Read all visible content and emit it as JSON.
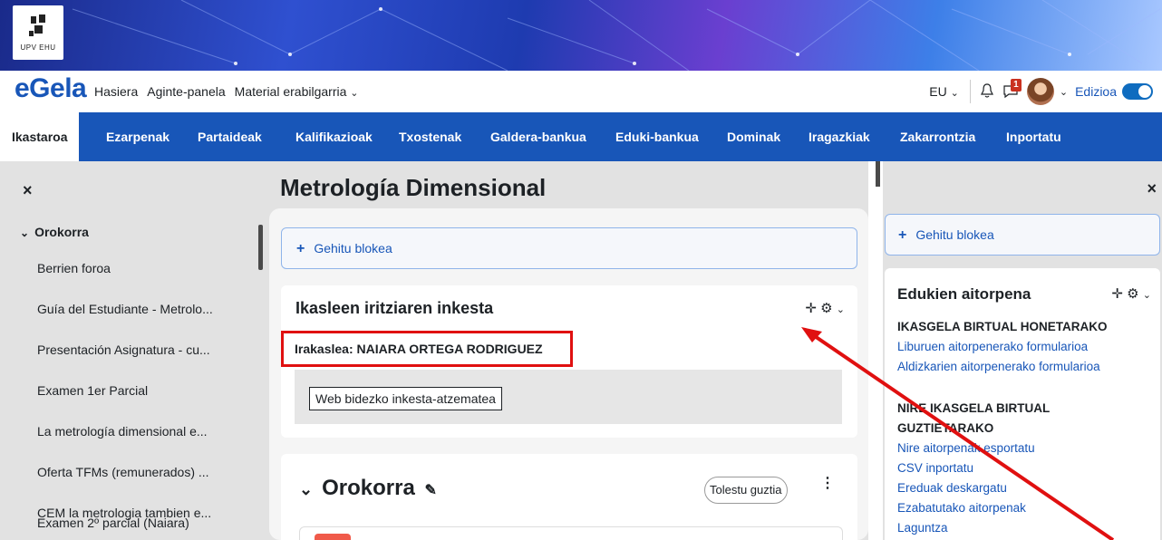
{
  "banner": {
    "logo_text": "UPV  EHU"
  },
  "navbar": {
    "brand": "eGela",
    "links": [
      "Hasiera",
      "Aginte-panela",
      "Material erabilgarria"
    ],
    "lang": "EU",
    "message_badge": "1",
    "edit_label": "Edizioa"
  },
  "secondary_nav": {
    "tabs": [
      "Ikastaroa",
      "Ezarpenak",
      "Partaideak",
      "Kalifikazioak",
      "Txostenak",
      "Galdera-bankua",
      "Eduki-bankua",
      "Dominak",
      "Iragazkiak",
      "Zakarrontzia",
      "Inportatu"
    ],
    "active": "Ikastaroa"
  },
  "left_drawer": {
    "close": "×",
    "section": "Orokorra",
    "items": [
      "Berrien foroa",
      "Guía del Estudiante - Metrolo...",
      "Presentación Asignatura - cu...",
      "Examen 1er Parcial",
      "La metrología dimensional e...",
      "Oferta TFMs (remunerados) ...",
      "CEM la metrologia tambien e...",
      "Examen 2º parcial (Naiara)"
    ]
  },
  "main": {
    "title": "Metrología Dimensional",
    "add_block": "Gehitu blokea",
    "block": {
      "title": "Ikasleen iritziaren inkesta",
      "teacher": "Irakaslea: NAIARA ORTEGA RODRIGUEZ",
      "button": "Web bidezko inkesta-atzematea"
    },
    "section": {
      "title": "Orokorra",
      "collapse": "Tolestu guztia"
    }
  },
  "right_drawer": {
    "close": "×",
    "add_block": "Gehitu blokea",
    "card": {
      "title": "Edukien aitorpena",
      "heading1": "IKASGELA BIRTUAL HONETARAKO",
      "links1": [
        "Liburuen aitorpenerako formularioa",
        "Aldizkarien aitorpenerako formularioa"
      ],
      "heading2_line1": "NIRE IKASGELA BIRTUAL",
      "heading2_line2": "GUZTIETARAKO",
      "links2": [
        "Nire aitorpenak esportatu",
        "CSV inportatu",
        "Ereduak deskargatu",
        "Ezabatutako aitorpenak",
        "Laguntza"
      ]
    }
  },
  "colors": {
    "brand_blue": "#1856b8",
    "highlight_red": "#e01010",
    "badge_red": "#ca3120"
  }
}
